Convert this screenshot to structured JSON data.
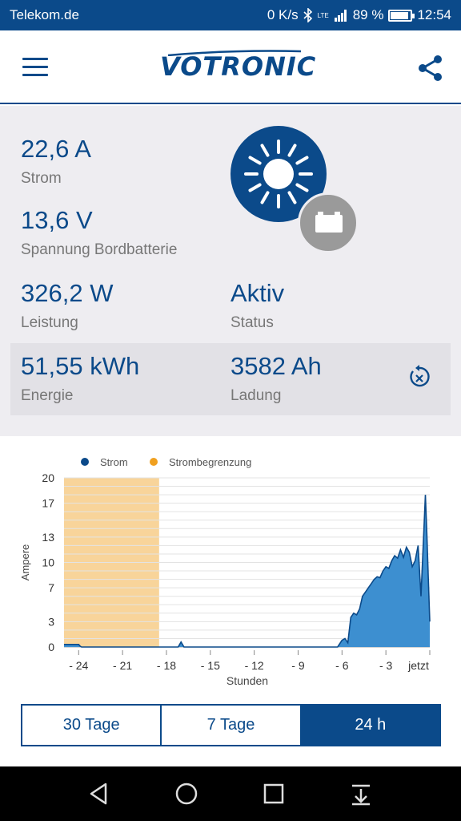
{
  "status_bar": {
    "carrier": "Telekom.de",
    "speed": "0 K/s",
    "network": "LTE",
    "battery_percent_text": "89 %",
    "battery_level": 0.89,
    "time": "12:54"
  },
  "app_bar": {
    "logo_text": "VOTRONIC"
  },
  "metrics": {
    "current": {
      "value": "22,6 A",
      "label": "Strom"
    },
    "voltage": {
      "value": "13,6 V",
      "label": "Spannung Bordbatterie"
    },
    "power": {
      "value": "326,2 W",
      "label": "Leistung"
    },
    "status": {
      "value": "Aktiv",
      "label": "Status"
    },
    "energy": {
      "value": "51,55 kWh",
      "label": "Energie"
    },
    "charge": {
      "value": "3582 Ah",
      "label": "Ladung"
    }
  },
  "colors": {
    "primary": "#0b4a8a",
    "strom": "#0b4a8a",
    "strombegrenzung": "#f0a020",
    "area_fill": "#3d8fd0"
  },
  "chart_data": {
    "type": "area",
    "legend": [
      "Strom",
      "Strombegrenzung"
    ],
    "ylabel": "Ampere",
    "xlabel": "Stunden",
    "ylim": [
      0,
      20
    ],
    "yticks": [
      0,
      3,
      7,
      10,
      13,
      17,
      20
    ],
    "xlim": [
      -25,
      0
    ],
    "xticks": [
      -24,
      -21,
      -18,
      -15,
      -12,
      -9,
      -6,
      -3,
      0
    ],
    "xtick_labels": [
      "- 24",
      "- 21",
      "- 18",
      "- 15",
      "- 12",
      "- 9",
      "- 6",
      "- 3",
      "jetzt"
    ],
    "strombegrenzung_band": [
      -25,
      -18.5
    ],
    "series": [
      {
        "name": "Strom",
        "x": [
          -25,
          -24,
          -23.9,
          -23.8,
          -17.2,
          -17.0,
          -16.8,
          -6.3,
          -6.0,
          -5.8,
          -5.6,
          -5.4,
          -5.2,
          -5.0,
          -4.8,
          -4.6,
          -4.4,
          -4.2,
          -4.0,
          -3.8,
          -3.6,
          -3.4,
          -3.2,
          -3.0,
          -2.8,
          -2.6,
          -2.4,
          -2.2,
          -2.0,
          -1.8,
          -1.6,
          -1.4,
          -1.2,
          -1.0,
          -0.8,
          -0.6,
          -0.4,
          -0.3,
          -0.2,
          -0.1,
          0
        ],
        "values": [
          0.3,
          0.3,
          0.1,
          0.0,
          0.0,
          0.6,
          0.0,
          0.0,
          0.8,
          1.0,
          0.5,
          3.5,
          4.0,
          3.8,
          4.5,
          6.0,
          6.5,
          7.0,
          7.5,
          8.0,
          8.3,
          8.2,
          9.0,
          9.5,
          9.3,
          10.2,
          10.8,
          10.5,
          11.5,
          10.6,
          11.8,
          11.2,
          9.5,
          10.2,
          12.0,
          6.0,
          14.0,
          18.0,
          13.5,
          8.0,
          3.0
        ]
      }
    ]
  },
  "tabs": [
    "30 Tage",
    "7 Tage",
    "24 h"
  ],
  "active_tab": "24 h"
}
